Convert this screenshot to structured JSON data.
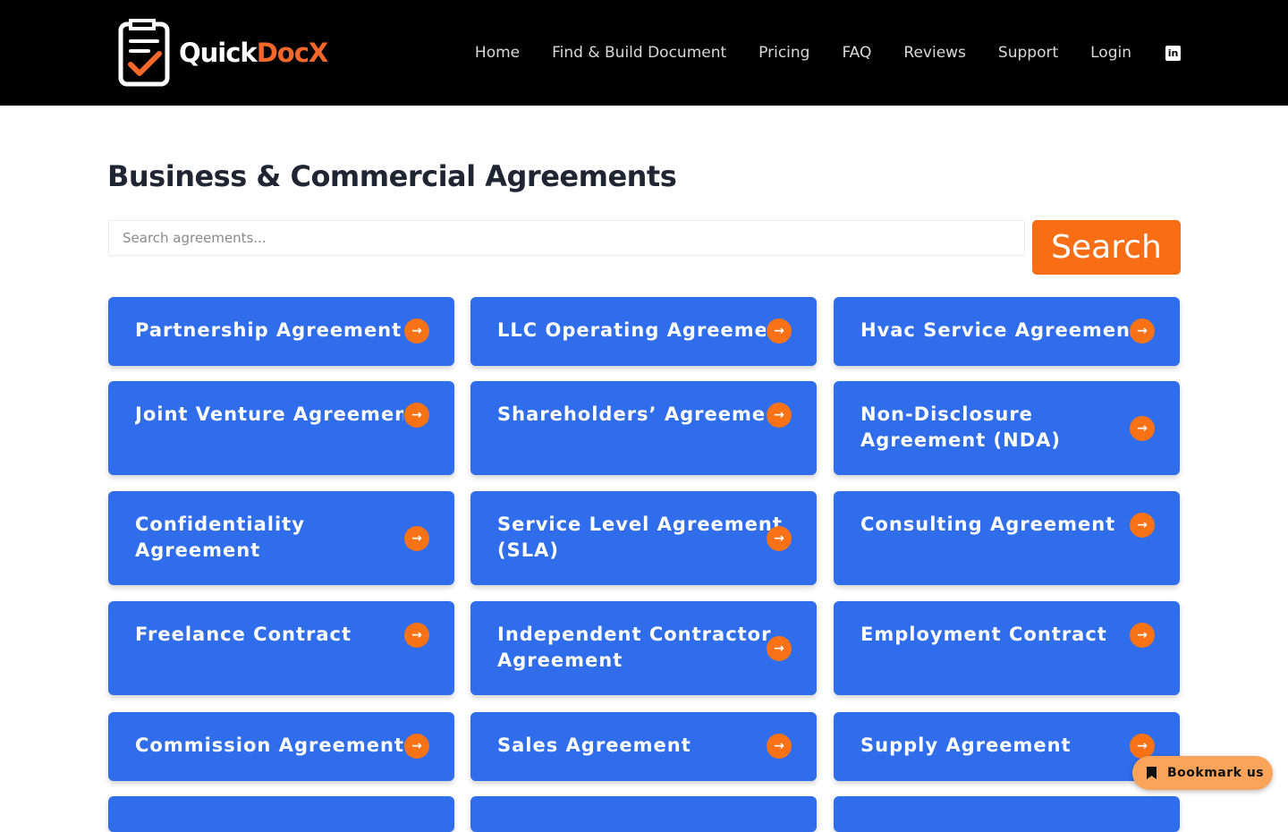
{
  "brand": {
    "name_part1": "Quick",
    "name_part2": "DocX"
  },
  "nav": {
    "items": [
      "Home",
      "Find & Build Document",
      "Pricing",
      "FAQ",
      "Reviews",
      "Support",
      "Login"
    ],
    "social_icon": "linkedin-icon",
    "social_glyph": "in"
  },
  "page": {
    "title": "Business & Commercial Agreements"
  },
  "search": {
    "placeholder": "Search agreements...",
    "value": "",
    "button_label": "Search"
  },
  "cards": [
    {
      "label": "Partnership Agreement"
    },
    {
      "label": "LLC Operating Agreement"
    },
    {
      "label": "Hvac Service Agreement"
    },
    {
      "label": "Joint Venture Agreement"
    },
    {
      "label": "Shareholders’ Agreement"
    },
    {
      "label": "Non-Disclosure Agreement (NDA)"
    },
    {
      "label": "Confidentiality Agreement"
    },
    {
      "label": "Service Level Agreement (SLA)"
    },
    {
      "label": "Consulting Agreement"
    },
    {
      "label": "Freelance Contract"
    },
    {
      "label": "Independent Contractor Agreement"
    },
    {
      "label": "Employment Contract"
    },
    {
      "label": "Commission Agreement"
    },
    {
      "label": "Sales Agreement"
    },
    {
      "label": "Supply Agreement"
    }
  ],
  "card_arrow_glyph": "→",
  "bookmark": {
    "label": "Bookmark us",
    "icon": "bookmark-icon"
  },
  "colors": {
    "accent": "#f96e14",
    "card": "#2f6deb",
    "header": "#000000",
    "arrow": "#f97316"
  }
}
